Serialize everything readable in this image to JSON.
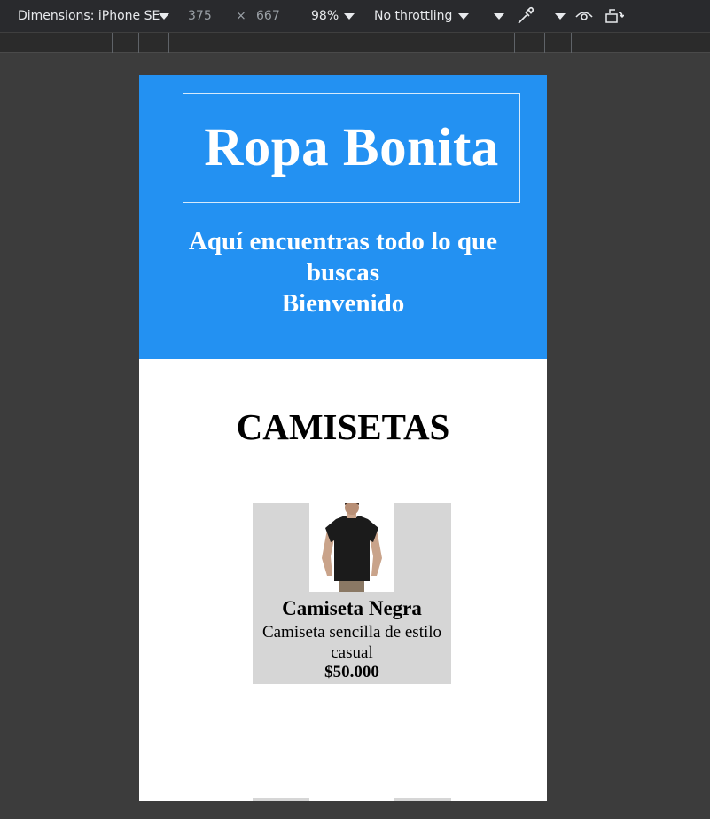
{
  "devtools": {
    "dimensions_label": "Dimensions: iPhone SE",
    "width": "375",
    "times": "×",
    "height": "667",
    "zoom": "98%",
    "throttling": "No throttling"
  },
  "hero": {
    "title": "Ropa Bonita",
    "tagline_line1": "Aquí encuentras todo lo que",
    "tagline_line2": "buscas",
    "tagline_line3": "Bienvenido"
  },
  "section": {
    "title": "CAMISETAS"
  },
  "products": [
    {
      "name": "Camiseta Negra",
      "description": "Camiseta sencilla de estilo casual",
      "price": "$50.000",
      "image": "black-tshirt-photo"
    }
  ],
  "colors": {
    "hero_bg": "#2391f2",
    "card_bg": "#d6d6d6",
    "devtools_bg": "#3c3c3c"
  }
}
